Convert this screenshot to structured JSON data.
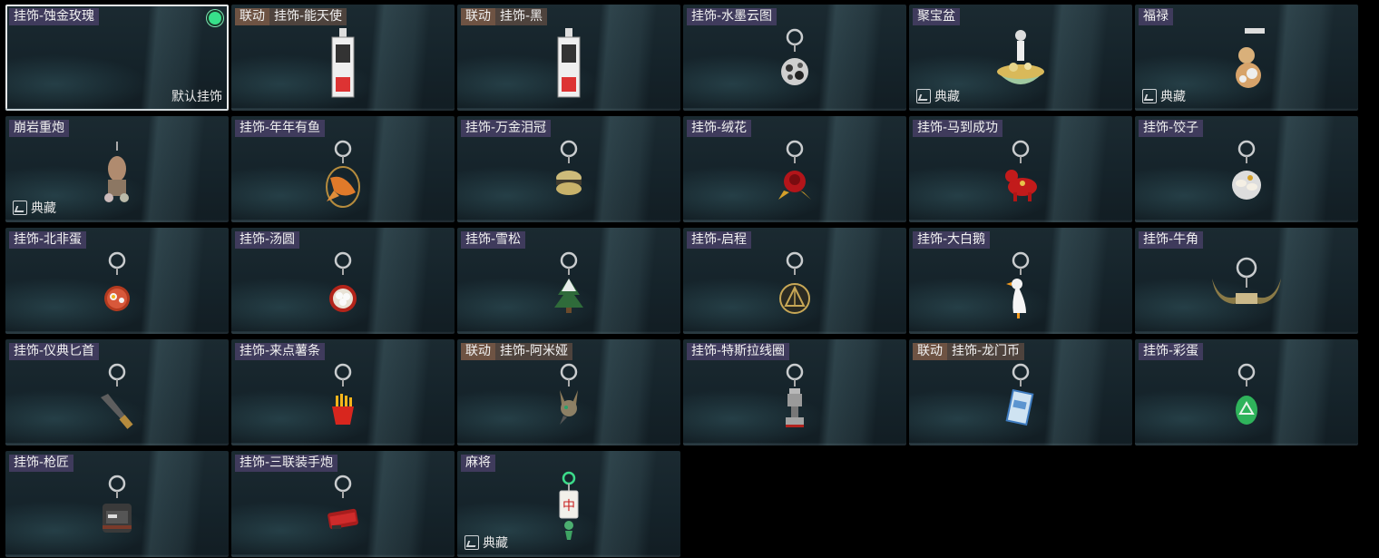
{
  "status_dot_color": "#37e08a",
  "items": [
    {
      "prefix": "",
      "title": "挂饰-蚀金玫瑰",
      "selected": true,
      "default_label": "默认挂饰",
      "collect": "",
      "icon": "none-icon"
    },
    {
      "prefix": "联动",
      "title": "挂饰-能天使",
      "selected": false,
      "default_label": "",
      "collect": "",
      "icon": "tag-card-icon"
    },
    {
      "prefix": "联动",
      "title": "挂饰-黑",
      "selected": false,
      "default_label": "",
      "collect": "",
      "icon": "tag-card-icon"
    },
    {
      "prefix": "",
      "title": "挂饰-水墨云图",
      "selected": false,
      "default_label": "",
      "collect": "",
      "icon": "ink-ball-icon"
    },
    {
      "prefix": "",
      "title": "聚宝盆",
      "selected": false,
      "default_label": "",
      "collect": "典藏",
      "icon": "treasure-bowl-icon"
    },
    {
      "prefix": "",
      "title": "福禄",
      "selected": false,
      "default_label": "",
      "collect": "典藏",
      "icon": "gourd-icon"
    },
    {
      "prefix": "",
      "title": "崩岩重炮",
      "selected": false,
      "default_label": "",
      "collect": "典藏",
      "icon": "figure-icon"
    },
    {
      "prefix": "",
      "title": "挂饰-年年有鱼",
      "selected": false,
      "default_label": "",
      "collect": "",
      "icon": "fish-icon"
    },
    {
      "prefix": "",
      "title": "挂饰-万金泪冠",
      "selected": false,
      "default_label": "",
      "collect": "",
      "icon": "golden-burger-icon"
    },
    {
      "prefix": "",
      "title": "挂饰-绒花",
      "selected": false,
      "default_label": "",
      "collect": "",
      "icon": "flower-icon"
    },
    {
      "prefix": "",
      "title": "挂饰-马到成功",
      "selected": false,
      "default_label": "",
      "collect": "",
      "icon": "red-horse-icon"
    },
    {
      "prefix": "",
      "title": "挂饰-饺子",
      "selected": false,
      "default_label": "",
      "collect": "",
      "icon": "dumpling-icon"
    },
    {
      "prefix": "",
      "title": "挂饰-北非蛋",
      "selected": false,
      "default_label": "",
      "collect": "",
      "icon": "pan-egg-icon"
    },
    {
      "prefix": "",
      "title": "挂饰-汤圆",
      "selected": false,
      "default_label": "",
      "collect": "",
      "icon": "bowl-icon"
    },
    {
      "prefix": "",
      "title": "挂饰-雪松",
      "selected": false,
      "default_label": "",
      "collect": "",
      "icon": "tree-icon"
    },
    {
      "prefix": "",
      "title": "挂饰-启程",
      "selected": false,
      "default_label": "",
      "collect": "",
      "icon": "medal-icon"
    },
    {
      "prefix": "",
      "title": "挂饰-大白鹅",
      "selected": false,
      "default_label": "",
      "collect": "",
      "icon": "goose-icon"
    },
    {
      "prefix": "",
      "title": "挂饰-牛角",
      "selected": false,
      "default_label": "",
      "collect": "",
      "icon": "horns-icon"
    },
    {
      "prefix": "",
      "title": "挂饰-仪典匕首",
      "selected": false,
      "default_label": "",
      "collect": "",
      "icon": "dagger-icon"
    },
    {
      "prefix": "",
      "title": "挂饰-来点薯条",
      "selected": false,
      "default_label": "",
      "collect": "",
      "icon": "fries-icon"
    },
    {
      "prefix": "联动",
      "title": "挂饰-阿米娅",
      "selected": false,
      "default_label": "",
      "collect": "",
      "icon": "bunny-icon"
    },
    {
      "prefix": "",
      "title": "挂饰-特斯拉线圈",
      "selected": false,
      "default_label": "",
      "collect": "",
      "icon": "coil-icon"
    },
    {
      "prefix": "联动",
      "title": "挂饰-龙门币",
      "selected": false,
      "default_label": "",
      "collect": "",
      "icon": "card-icon"
    },
    {
      "prefix": "",
      "title": "挂饰-彩蛋",
      "selected": false,
      "default_label": "",
      "collect": "",
      "icon": "green-egg-icon"
    },
    {
      "prefix": "",
      "title": "挂饰-枪匠",
      "selected": false,
      "default_label": "",
      "collect": "",
      "icon": "backpack-icon"
    },
    {
      "prefix": "",
      "title": "挂饰-三联装手炮",
      "selected": false,
      "default_label": "",
      "collect": "",
      "icon": "launcher-icon"
    },
    {
      "prefix": "",
      "title": "麻将",
      "selected": false,
      "default_label": "",
      "collect": "典藏",
      "icon": "mahjong-icon"
    }
  ]
}
